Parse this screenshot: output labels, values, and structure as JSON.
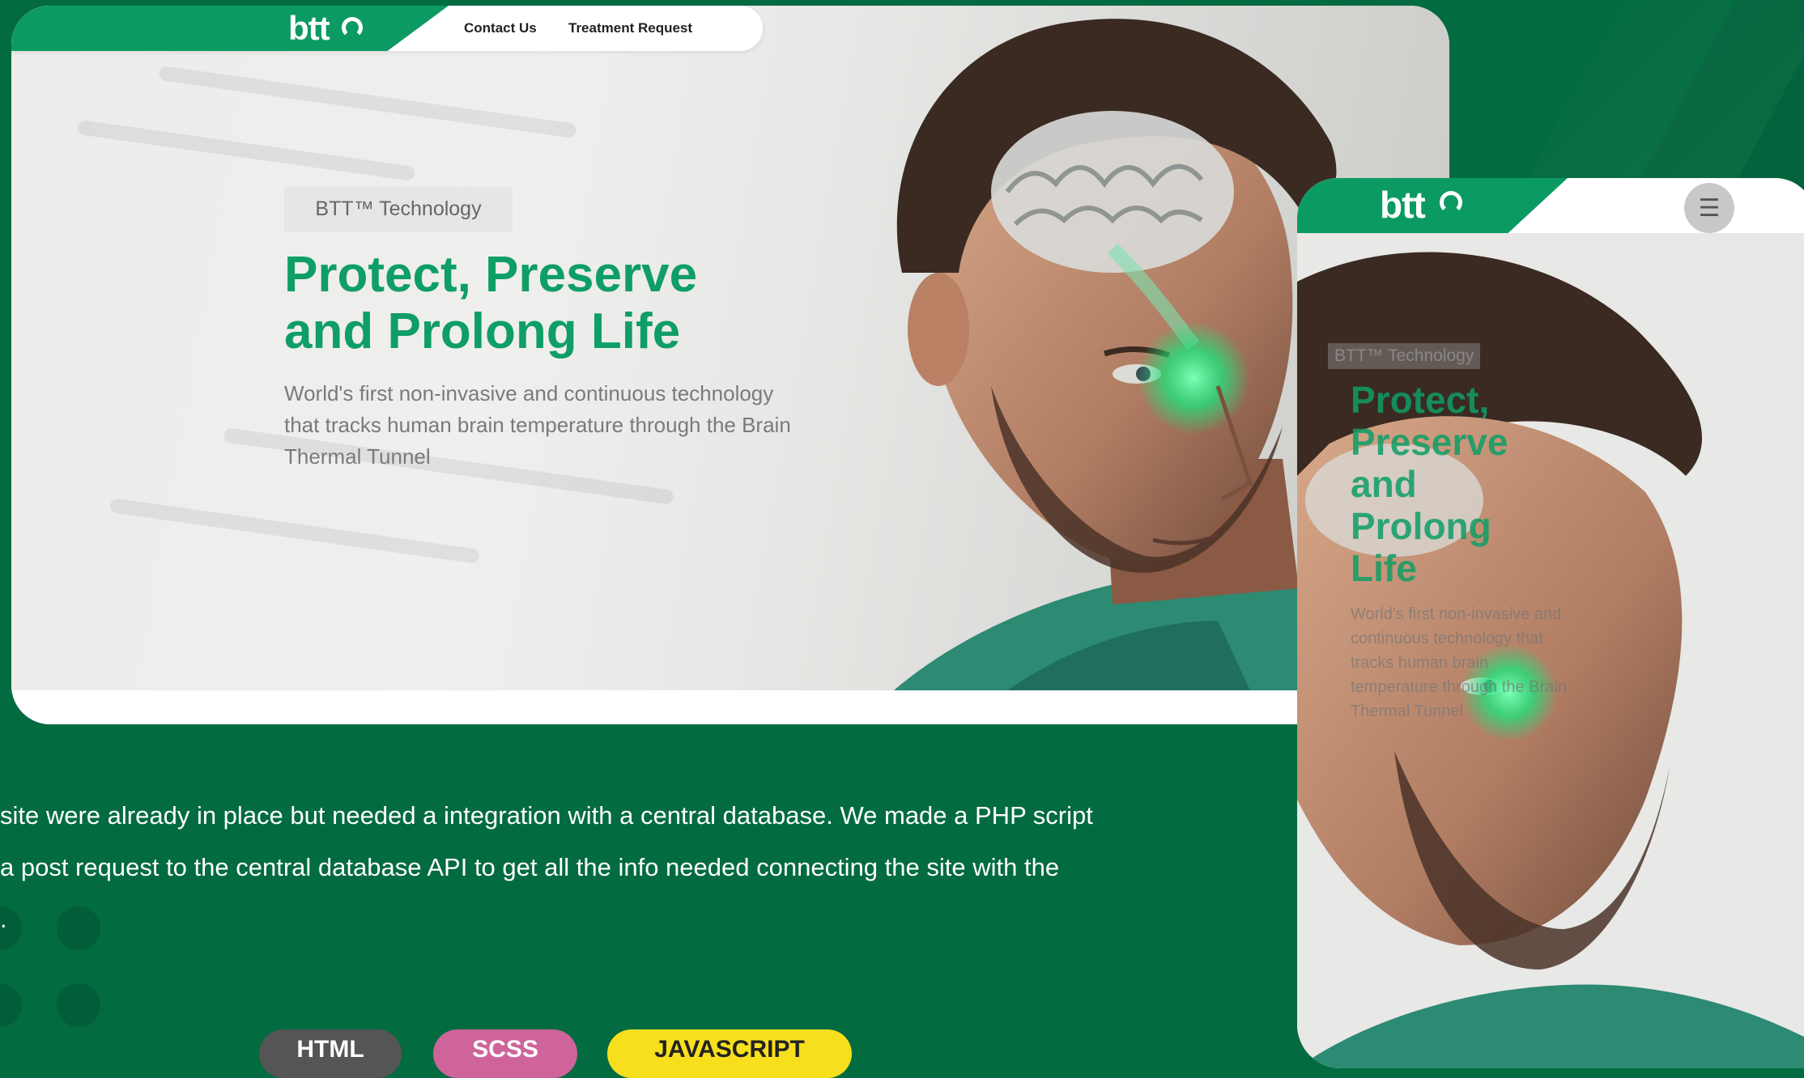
{
  "desktop": {
    "nav": {
      "logo": "btt",
      "links": [
        "Contact Us",
        "Treatment Request"
      ]
    },
    "badge": "BTT™ Technology",
    "title": "Protect, Preserve and Prolong Life",
    "subtitle": "World's first non-invasive and continuous technology that tracks human brain temperature through the Brain Thermal Tunnel"
  },
  "mobile": {
    "logo": "btt",
    "menu_icon": "hamburger-icon",
    "badge": "BTT™ Technology",
    "title": "Protect, Preserve and Prolong Life",
    "subtitle": "World's first non-invasive and continuous technology that tracks human brain temperature through the Brain Thermal Tunnel"
  },
  "description": {
    "line1": "site were already in place but needed a integration with a central database. We made a PHP script",
    "line2": "a post request to the central database API to get all the info needed connecting the site with the",
    "line3": "."
  },
  "tags": [
    {
      "label": "HTML",
      "color": "#555555"
    },
    {
      "label": "SCSS",
      "color": "#cf649a"
    },
    {
      "label": "JAVASCRIPT",
      "color": "#f7df1e"
    }
  ],
  "colors": {
    "background": "#036b40",
    "brand_green": "#0c9a63",
    "title_green": "#0e9e66"
  }
}
